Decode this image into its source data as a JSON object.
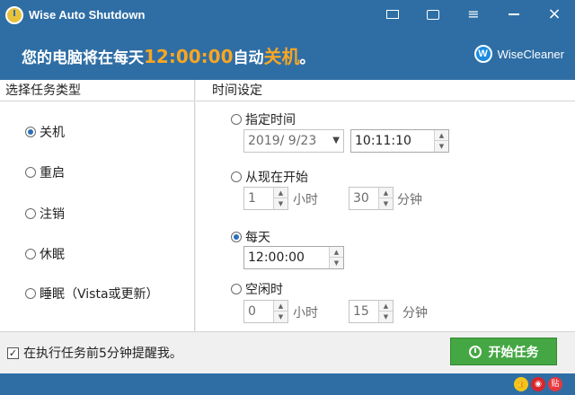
{
  "window": {
    "title": "Wise Auto Shutdown"
  },
  "banner": {
    "prefix": "您的电脑将在每天",
    "time": "12:00:00",
    "middle": "自动",
    "action": "关机",
    "suffix": "。",
    "brand": "WiseCleaner",
    "brand_icon_letter": "W"
  },
  "task_type": {
    "header": "选择任务类型",
    "options": [
      "关机",
      "重启",
      "注销",
      "休眠",
      "睡眠（Vista或更新）"
    ],
    "selected": "关机"
  },
  "time_settings": {
    "header": "时间设定",
    "specified": {
      "label": "指定时间",
      "date": "2019/ 9/23",
      "time": "10:11:10"
    },
    "from_now": {
      "label": "从现在开始",
      "hours": "1",
      "hours_unit": "小时",
      "minutes": "30",
      "minutes_unit": "分钟"
    },
    "daily": {
      "label": "每天",
      "time": "12:00:00"
    },
    "idle": {
      "label": "空闲时",
      "hours": "0",
      "hours_unit": "小时",
      "minutes": "15",
      "minutes_unit": "分钟"
    },
    "selected": "每天"
  },
  "footer": {
    "reminder_label": "在执行任务前5分钟提醒我。",
    "reminder_checked": true,
    "start_button": "开始任务"
  },
  "statusbar": {
    "feed_icon_text": "贴"
  },
  "colors": {
    "title_bar": "#2f6ea5",
    "highlight": "#f7a623",
    "start_button": "#45a744"
  }
}
